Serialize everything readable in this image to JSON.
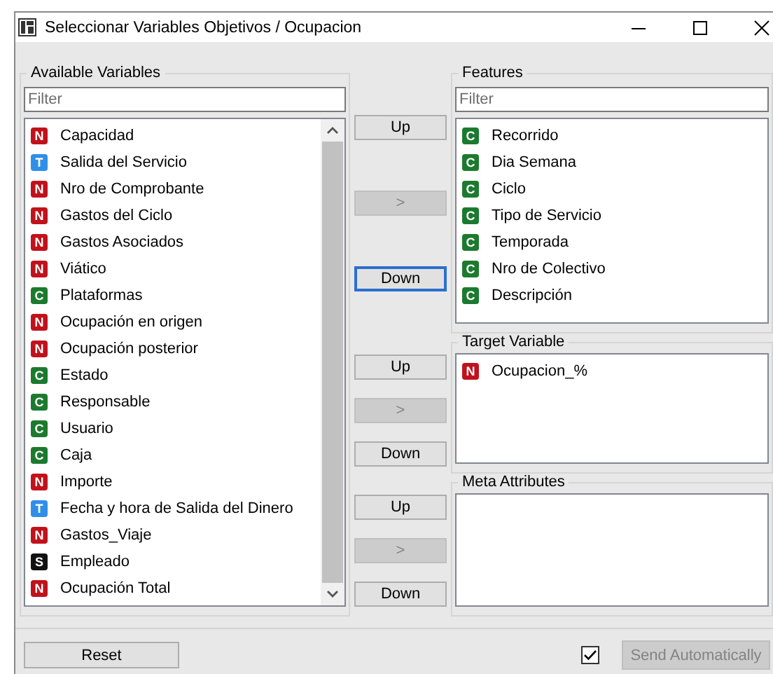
{
  "window": {
    "title": "Seleccionar Variables Objetivos / Ocupacion"
  },
  "available_variables": {
    "title": "Available Variables",
    "filter": {
      "placeholder": "Filter"
    },
    "items": [
      {
        "kind": "numeric",
        "badge": "N",
        "name": "Capacidad"
      },
      {
        "kind": "time",
        "badge": "T",
        "name": "Salida del Servicio"
      },
      {
        "kind": "numeric",
        "badge": "N",
        "name": "Nro de Comprobante"
      },
      {
        "kind": "numeric",
        "badge": "N",
        "name": "Gastos del Ciclo"
      },
      {
        "kind": "numeric",
        "badge": "N",
        "name": "Gastos Asociados"
      },
      {
        "kind": "numeric",
        "badge": "N",
        "name": "Viático"
      },
      {
        "kind": "categorical",
        "badge": "C",
        "name": "Plataformas"
      },
      {
        "kind": "numeric",
        "badge": "N",
        "name": "Ocupación en origen"
      },
      {
        "kind": "numeric",
        "badge": "N",
        "name": "Ocupación posterior"
      },
      {
        "kind": "categorical",
        "badge": "C",
        "name": "Estado"
      },
      {
        "kind": "categorical",
        "badge": "C",
        "name": "Responsable"
      },
      {
        "kind": "categorical",
        "badge": "C",
        "name": "Usuario"
      },
      {
        "kind": "categorical",
        "badge": "C",
        "name": "Caja"
      },
      {
        "kind": "numeric",
        "badge": "N",
        "name": "Importe"
      },
      {
        "kind": "time",
        "badge": "T",
        "name": "Fecha y hora de Salida del Dinero"
      },
      {
        "kind": "numeric",
        "badge": "N",
        "name": "Gastos_Viaje"
      },
      {
        "kind": "string",
        "badge": "S",
        "name": "Empleado"
      },
      {
        "kind": "numeric",
        "badge": "N",
        "name": "Ocupación Total"
      }
    ]
  },
  "move_buttons": [
    {
      "buttons": [
        {
          "label": "Up",
          "disabled": false,
          "focused": false
        },
        {
          "label": ">",
          "disabled": true,
          "focused": false
        },
        {
          "label": "Down",
          "disabled": false,
          "focused": true
        }
      ]
    },
    {
      "buttons": [
        {
          "label": "Up",
          "disabled": false,
          "focused": false
        },
        {
          "label": ">",
          "disabled": true,
          "focused": false
        },
        {
          "label": "Down",
          "disabled": false,
          "focused": false
        }
      ]
    },
    {
      "buttons": [
        {
          "label": "Up",
          "disabled": false,
          "focused": false
        },
        {
          "label": ">",
          "disabled": true,
          "focused": false
        },
        {
          "label": "Down",
          "disabled": false,
          "focused": false
        }
      ]
    }
  ],
  "features": {
    "title": "Features",
    "filter": {
      "placeholder": "Filter"
    },
    "items": [
      {
        "kind": "categorical",
        "badge": "C",
        "name": "Recorrido"
      },
      {
        "kind": "categorical",
        "badge": "C",
        "name": "Dia Semana"
      },
      {
        "kind": "categorical",
        "badge": "C",
        "name": "Ciclo"
      },
      {
        "kind": "categorical",
        "badge": "C",
        "name": "Tipo de Servicio"
      },
      {
        "kind": "categorical",
        "badge": "C",
        "name": "Temporada"
      },
      {
        "kind": "categorical",
        "badge": "C",
        "name": "Nro de Colectivo"
      },
      {
        "kind": "categorical",
        "badge": "C",
        "name": "Descripción"
      }
    ]
  },
  "target_variable": {
    "title": "Target Variable",
    "items": [
      {
        "kind": "numeric",
        "badge": "N",
        "name": "Ocupacion_%"
      }
    ]
  },
  "meta_attributes": {
    "title": "Meta Attributes"
  },
  "reset_button": {
    "label": "Reset"
  },
  "send_automatically": {
    "checked": true,
    "label": "Send Automatically",
    "disabled": true
  }
}
